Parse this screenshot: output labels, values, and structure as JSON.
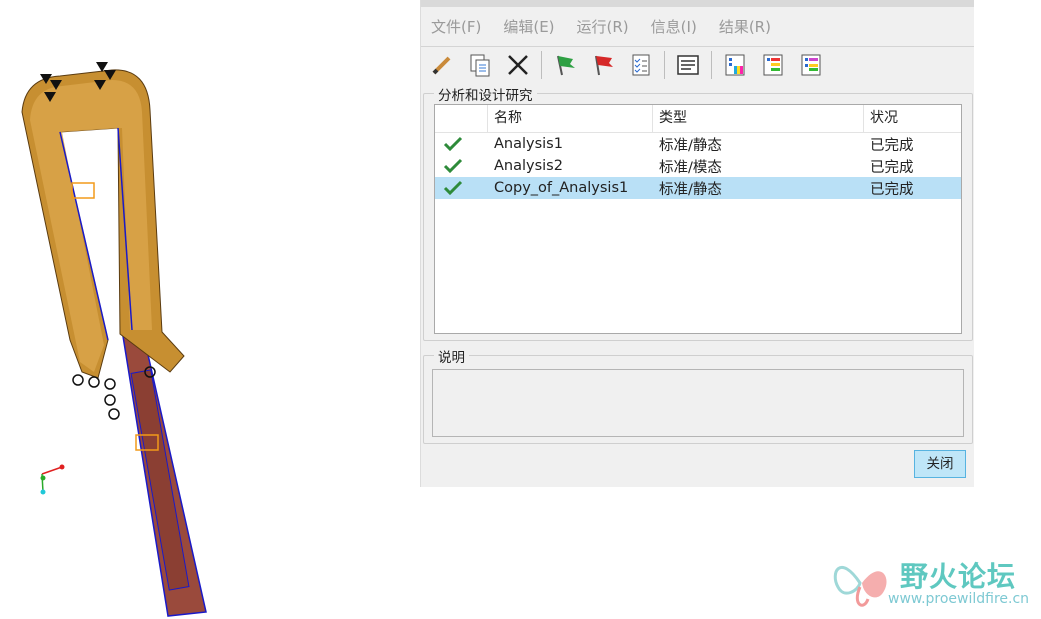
{
  "menu": [
    "文件(F)",
    "编辑(E)",
    "运行(R)",
    "信息(I)",
    "结果(R)"
  ],
  "toolbar": {
    "icons": [
      "pencil-icon",
      "new-doc-icon",
      "delete-x-icon",
      "green-flag-icon",
      "red-flag-icon",
      "checklist-icon",
      "summary-icon",
      "results-color-icon",
      "results-table-icon",
      "results-compare-icon"
    ]
  },
  "analysis_group": {
    "title": "分析和设计研究",
    "columns": [
      "",
      "名称",
      "类型",
      "状况"
    ],
    "rows": [
      {
        "name": "Analysis1",
        "type": "标准/静态",
        "status": "已完成"
      },
      {
        "name": "Analysis2",
        "type": "标准/模态",
        "status": "已完成"
      },
      {
        "name": "Copy_of_Analysis1",
        "type": "标准/静态",
        "status": "已完成"
      }
    ]
  },
  "description_group": {
    "title": "说明"
  },
  "close_label": "关闭",
  "watermark": {
    "title": "野火论坛",
    "url": "www.proewildfire.cn"
  },
  "colors": {
    "selection": "#b9e0f6",
    "accent_border": "#57b3e0",
    "check_green": "#2e8b3a",
    "model_orange": "#d59a3c",
    "model_red": "#9a4a3c"
  }
}
